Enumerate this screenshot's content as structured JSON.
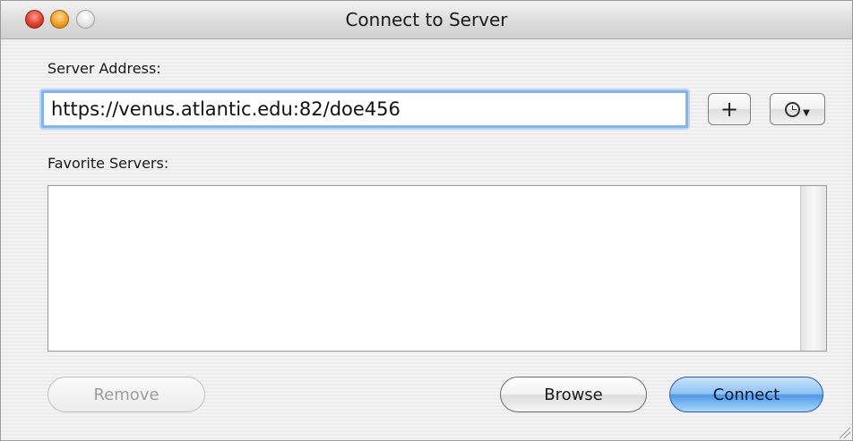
{
  "window": {
    "title": "Connect to Server"
  },
  "form": {
    "server_address_label": "Server Address:",
    "server_address_value": "https://venus.atlantic.edu:82/doe456",
    "add_favorite_label": "+",
    "recent_servers_icon": "clock-icon",
    "favorite_servers_label": "Favorite Servers:",
    "favorite_servers": []
  },
  "buttons": {
    "remove": "Remove",
    "browse": "Browse",
    "connect": "Connect"
  },
  "colors": {
    "accent": "#4d98e6",
    "focus_ring": "#84b4e8"
  }
}
